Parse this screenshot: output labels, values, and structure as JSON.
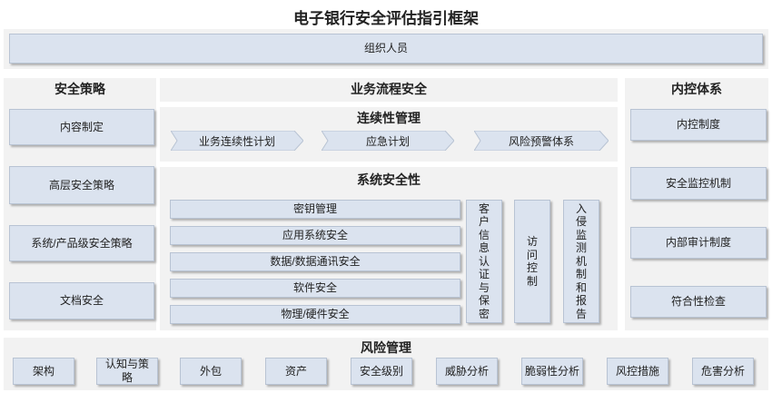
{
  "title": "电子银行安全评估指引框架",
  "top_bar": {
    "label": "组织人员"
  },
  "left_column": {
    "title": "安全策略",
    "items": [
      "内容制定",
      "高层安全策略",
      "系统/产品级安全策略",
      "文档安全"
    ]
  },
  "middle_column": {
    "title": "业务流程安全",
    "continuity": {
      "title": "连续性管理",
      "steps": [
        "业务连续性计划",
        "应急计划",
        "风险预警体系"
      ]
    },
    "system_security": {
      "title": "系统安全性",
      "items": [
        "密钥管理",
        "应用系统安全",
        "数据/数据通讯安全",
        "软件安全",
        "物理/硬件安全"
      ],
      "vertical": [
        "客户信息认证与保密",
        "访问控制",
        "入侵监测机制和报告"
      ]
    }
  },
  "right_column": {
    "title": "内控体系",
    "items": [
      "内控制度",
      "安全监控机制",
      "内部审计制度",
      "符合性检查"
    ]
  },
  "bottom_section": {
    "title": "风险管理",
    "items": [
      "架构",
      "认知与策略",
      "外包",
      "资产",
      "安全级别",
      "威胁分析",
      "脆弱性分析",
      "风控措施",
      "危害分析"
    ]
  }
}
